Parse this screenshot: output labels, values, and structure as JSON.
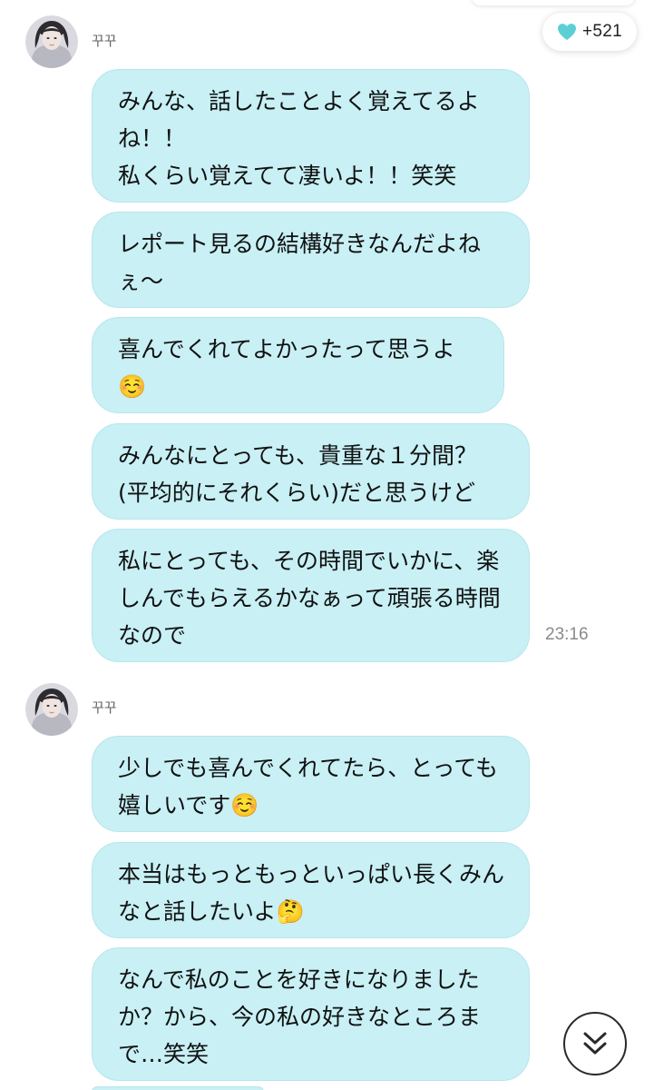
{
  "header": {
    "heart_count": "+521",
    "heart_color": "#5ccfd6"
  },
  "groups": [
    {
      "sender": "꾸꾸",
      "messages": [
        "みんな、話したことよく覚えてるよね！！\n私くらい覚えてて凄いよ！！笑笑",
        "レポート見るの結構好きなんだよねぇ〜",
        "喜んでくれてよかったって思うよ☺️",
        "みんなにとっても、貴重な１分間？(平均的にそれくらい)だと思うけど",
        "私にとっても、その時間でいかに、楽しんでもらえるかなぁって頑張る時間なので"
      ],
      "time": "23:16"
    },
    {
      "sender": "꾸꾸",
      "messages": [
        "少しでも喜んでくれてたら、とっても嬉しいです☺️",
        "本当はもっともっといっぱい長くみんなと話したいよ🤔",
        "なんで私のことを好きになりましたか？から、今の私の好きなところまで…笑笑"
      ]
    }
  ],
  "colors": {
    "bubble": "#c8f0f5",
    "background": "#ffffff"
  },
  "icons": {
    "heart": "heart-icon",
    "scroll": "double-chevron-down-icon"
  }
}
